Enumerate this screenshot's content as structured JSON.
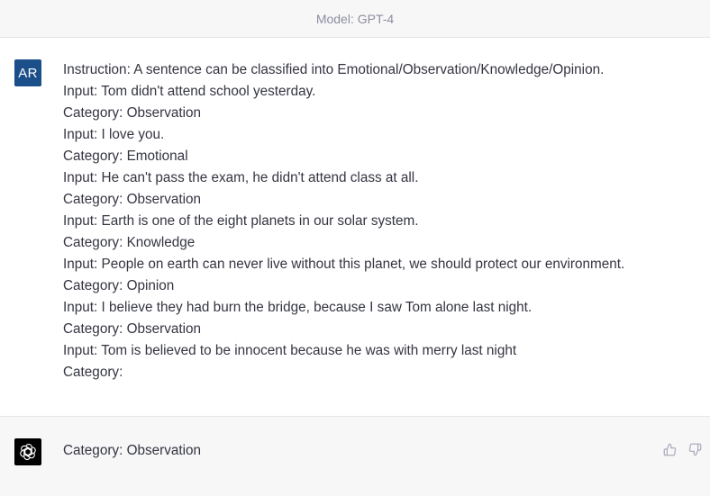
{
  "header": {
    "model_label": "Model: GPT-4"
  },
  "user_message": {
    "avatar_initials": "AR",
    "avatar_color": "#1a4f8a",
    "lines": [
      "Instruction: A sentence can be classified into Emotional/Observation/Knowledge/Opinion.",
      "Input: Tom didn't attend school yesterday.",
      "Category: Observation",
      "Input: I love you.",
      "Category: Emotional",
      "Input: He can't pass the exam, he didn't attend class at all.",
      "Category: Observation",
      "Input: Earth is one of the eight planets in our solar system.",
      "Category: Knowledge",
      "Input: People on earth can never live without this planet, we should protect our environment.",
      "Category: Opinion",
      "Input: I believe they had burn the bridge, because I saw Tom alone last night.",
      "Category: Observation",
      "Input: Tom is believed to be innocent because he was with merry last night",
      "Category:"
    ]
  },
  "assistant_message": {
    "avatar_icon": "openai-logo-icon",
    "text": "Category: Observation",
    "feedback_icons": [
      "thumbs-up-icon",
      "thumbs-down-icon"
    ]
  }
}
